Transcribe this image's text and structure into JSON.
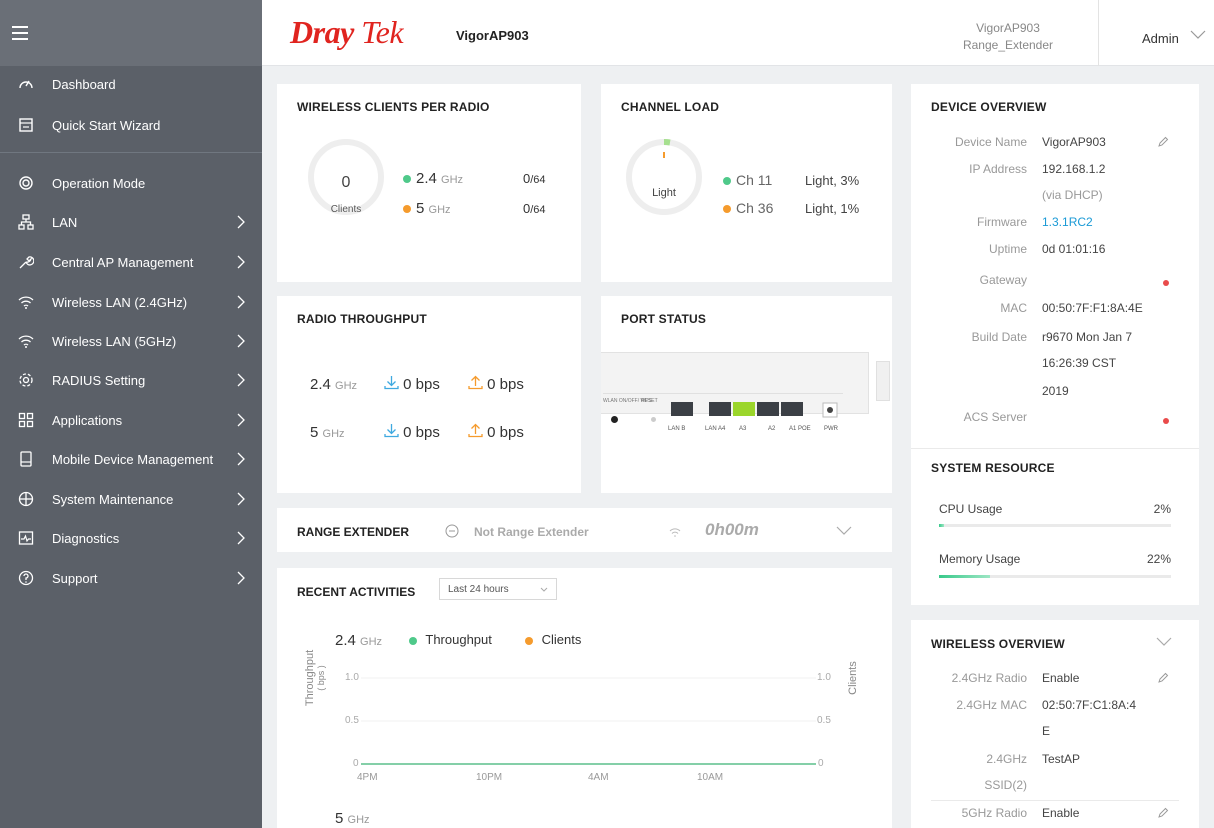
{
  "sidebar": {
    "items": [
      {
        "label": "Dashboard",
        "icon": "gauge-icon"
      },
      {
        "label": "Quick Start Wizard",
        "icon": "wizard-icon"
      },
      {
        "label": "Operation Mode",
        "icon": "operation-mode-icon"
      },
      {
        "label": "LAN",
        "icon": "lan-icon"
      },
      {
        "label": "Central AP Management",
        "icon": "wrench-icon"
      },
      {
        "label": "Wireless LAN (2.4GHz)",
        "icon": "wifi-icon"
      },
      {
        "label": "Wireless LAN (5GHz)",
        "icon": "wifi-icon"
      },
      {
        "label": "RADIUS Setting",
        "icon": "gear-icon"
      },
      {
        "label": "Applications",
        "icon": "applications-icon"
      },
      {
        "label": "Mobile Device Management",
        "icon": "mobile-icon"
      },
      {
        "label": "System Maintenance",
        "icon": "maintenance-icon"
      },
      {
        "label": "Diagnostics",
        "icon": "diagnostics-icon"
      },
      {
        "label": "Support",
        "icon": "help-icon"
      }
    ]
  },
  "header": {
    "logo_dray": "Dray",
    "logo_tek": "Tek",
    "model": "VigorAP903",
    "device_name": "VigorAP903",
    "device_mode": "Range_Extender",
    "user": "Admin"
  },
  "wireless_clients": {
    "title": "WIRELESS CLIENTS PER RADIO",
    "count": "0",
    "count_label": "Clients",
    "bands": [
      {
        "band": "2.4",
        "unit": "GHz",
        "value": "0",
        "max": "/64"
      },
      {
        "band": "5",
        "unit": "GHz",
        "value": "0",
        "max": "/64"
      }
    ]
  },
  "channel_load": {
    "title": "CHANNEL LOAD",
    "center": "Light",
    "channels": [
      {
        "name": "Ch 11",
        "value": "Light, 3%"
      },
      {
        "name": "Ch 36",
        "value": "Light, 1%"
      }
    ]
  },
  "radio_throughput": {
    "title": "RADIO THROUGHPUT",
    "rows": [
      {
        "band": "2.4",
        "unit": "GHz",
        "down": "0 bps",
        "up": "0 bps"
      },
      {
        "band": "5",
        "unit": "GHz",
        "down": "0 bps",
        "up": "0 bps"
      }
    ]
  },
  "port_status": {
    "title": "PORT STATUS",
    "labels": {
      "wlan": "WLAN ON/OFF/ WPS",
      "reset": "RESET",
      "lan_b": "LAN B",
      "lan_a4": "LAN A4",
      "a3": "A3",
      "a2": "A2",
      "a1poe": "A1 POE",
      "pwr": "PWR"
    }
  },
  "range_extender": {
    "title": "RANGE EXTENDER",
    "status": "Not Range Extender",
    "time": "0h00m"
  },
  "recent": {
    "title": "RECENT ACTIVITIES",
    "period": "Last 24 hours",
    "band1": "2.4",
    "band2": "5",
    "unit": "GHz",
    "legend_throughput": "Throughput",
    "legend_clients": "Clients",
    "ylabel_left": "Throughput",
    "ylabel_left_unit": "( bps )",
    "ylabel_right": "Clients",
    "yticks": [
      "1.0",
      "0.5",
      "0"
    ],
    "xticks": [
      "4PM",
      "10PM",
      "4AM",
      "10AM"
    ]
  },
  "device_overview": {
    "title": "DEVICE OVERVIEW",
    "device_name_label": "Device Name",
    "device_name": "VigorAP903",
    "ip_label": "IP Address",
    "ip": "192.168.1.2",
    "ip_note": "(via DHCP)",
    "firmware_label": "Firmware",
    "firmware": "1.3.1RC2",
    "uptime_label": "Uptime",
    "uptime": "0d 01:01:16",
    "gateway_label": "Gateway",
    "mac_label": "MAC",
    "mac": "00:50:7F:F1:8A:4E",
    "build_label": "Build Date",
    "build_1": "r9670 Mon Jan 7",
    "build_2": "16:26:39 CST",
    "build_3": "2019",
    "acs_label": "ACS Server"
  },
  "system_resource": {
    "title": "SYSTEM RESOURCE",
    "cpu_label": "CPU Usage",
    "cpu_value": "2%",
    "cpu_fraction": 0.02,
    "mem_label": "Memory Usage",
    "mem_value": "22%",
    "mem_fraction": 0.22
  },
  "wireless_overview": {
    "title": "WIRELESS OVERVIEW",
    "radio24_label": "2.4GHz Radio",
    "radio24": "Enable",
    "mac24_label": "2.4GHz MAC",
    "mac24_a": "02:50:7F:C1:8A:4",
    "mac24_b": "E",
    "ssid_label_a": "2.4GHz",
    "ssid_label_b": "SSID(2)",
    "ssid": "TestAP",
    "radio5_label": "5GHz Radio",
    "radio5": "Enable"
  },
  "colors": {
    "accent_green": "#4fc98a",
    "accent_orange": "#f59b2d",
    "brand_red": "#e0241f",
    "link_blue": "#1a9ad6"
  }
}
